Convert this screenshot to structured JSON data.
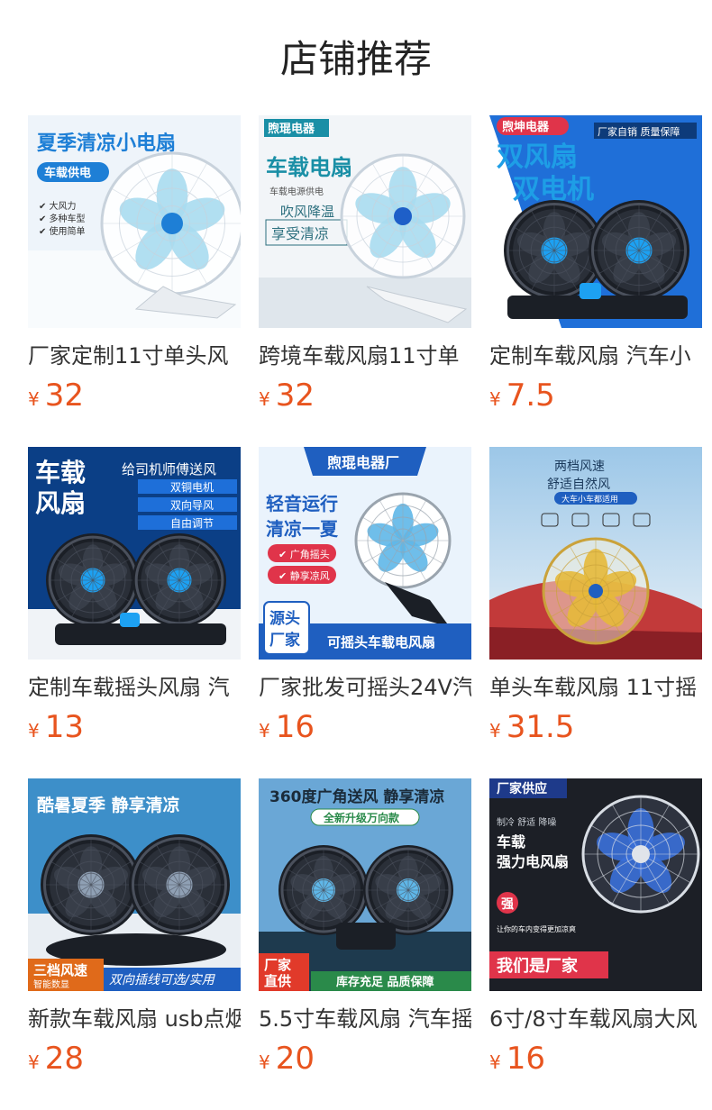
{
  "header": {
    "title": "店铺推荐"
  },
  "currency_symbol": "¥",
  "products": [
    {
      "name": "厂家定制11寸单头风",
      "price": "32",
      "image_text": [
        "夏季清凉小电扇",
        "车载供电",
        "大风力",
        "多种车型",
        "使用简单"
      ],
      "colors": {
        "bg": "#eef4fa",
        "accent": "#1e7fd6",
        "blade": "#a9dcf0"
      }
    },
    {
      "name": "跨境车载风扇11寸单",
      "price": "32",
      "image_text": [
        "煦琨电器",
        "车载电扇",
        "车载电源供电",
        "吹风降温",
        "享受清凉"
      ],
      "colors": {
        "bg": "#f2f5f8",
        "accent": "#1a8fa6",
        "blade": "#a9dcf0"
      }
    },
    {
      "name": "定制车载风扇 汽车小",
      "price": "7.5",
      "image_text": [
        "煦坤电器",
        "厂家自销 质量保障",
        "双风扇",
        "双电机"
      ],
      "colors": {
        "bg": "#1f6fd8",
        "accent": "#1e5fc8",
        "blade": "#1da1f2"
      }
    },
    {
      "name": "定制车载摇头风扇 汽",
      "price": "13",
      "image_text": [
        "车载",
        "风扇",
        "给司机师傅送风",
        "双铜电机",
        "双向导风",
        "自由调节"
      ],
      "colors": {
        "bg": "#0b3f86",
        "accent": "#1e6fd9",
        "blade": "#1da1f2"
      }
    },
    {
      "name": "厂家批发可摇头24V汽",
      "price": "16",
      "image_text": [
        "煦琨电器厂",
        "轻音运行",
        "清凉一夏",
        "广角摇头",
        "静享凉风",
        "源头",
        "厂家",
        "可摇头车载电风扇"
      ],
      "colors": {
        "bg": "#eaf3fc",
        "accent": "#1f5fc0",
        "blade": "#5fb7e8"
      }
    },
    {
      "name": "单头车载风扇 11寸摇",
      "price": "31.5",
      "image_text": [
        "两档风速",
        "舒适自然风",
        "大车小车都适用"
      ],
      "colors": {
        "bg": "#bcd9ef",
        "accent": "#1f5fc0",
        "blade": "#e6b93a"
      }
    },
    {
      "name": "新款车载风扇 usb点烟",
      "price": "28",
      "image_text": [
        "酷暑夏季 静享清凉",
        "三档风速",
        "智能数显",
        "双向插线可选/实用"
      ],
      "colors": {
        "bg": "#3d8fc9",
        "accent": "#e06a1a",
        "blade": "#333a44"
      }
    },
    {
      "name": "5.5寸车载风扇 汽车摇",
      "price": "20",
      "image_text": [
        "360度广角送风 静享清凉",
        "全新升级万向款",
        "厂家",
        "直供",
        "库存充足 品质保障"
      ],
      "colors": {
        "bg": "#6aa7d6",
        "accent": "#e13a2a",
        "blade": "#2d5b7a"
      }
    },
    {
      "name": "6寸/8寸车载风扇大风",
      "price": "16",
      "image_text": [
        "厂家供应",
        "制冷 舒适 降噪",
        "车载",
        "强力电风扇",
        "强",
        "让你的车内变得更加凉爽",
        "我们是厂家"
      ],
      "colors": {
        "bg": "#1c1f26",
        "accent": "#e0344a",
        "blade": "#3a6fd8"
      }
    }
  ]
}
